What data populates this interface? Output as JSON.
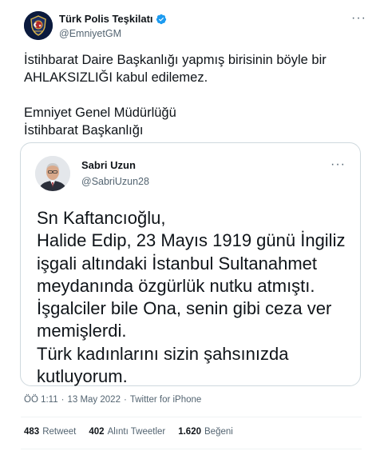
{
  "author": {
    "name": "Türk Polis Teşkilatı",
    "handle": "@EmniyetGM",
    "verified": true
  },
  "tweet": {
    "text": "İstihbarat Daire Başkanlığı yapmış birisinin böyle bir AHLAKSIZLIĞI kabul edilemez.\n\nEmniyet Genel Müdürlüğü\nİstihbarat Başkanlığı"
  },
  "quoted": {
    "name": "Sabri Uzun",
    "handle": "@SabriUzun28",
    "text": "Sn Kaftancıoğlu,\nHalide Edip, 23 Mayıs 1919 günü İngiliz işgali altındaki İstanbul Sultanahmet meydanında özgürlük nutku atmıştı.\nİşgalciler bile Ona, senin gibi ceza ver memişlerdi.\nTürk kadınlarını sizin şahsınızda kutluyorum."
  },
  "meta": {
    "time": "ÖÖ 1:11",
    "separator": "·",
    "date": "13 May 2022",
    "source": "Twitter for iPhone"
  },
  "stats": {
    "retweets": "483",
    "retweets_label": "Retweet",
    "quotes": "402",
    "quotes_label": "Alıntı Tweetler",
    "likes": "1.620",
    "likes_label": "Beğeni"
  },
  "more_glyph": "···",
  "colors": {
    "text": "#0f1419",
    "secondary": "#536471",
    "verified": "#1d9bf0",
    "border": "#cfd9de"
  }
}
